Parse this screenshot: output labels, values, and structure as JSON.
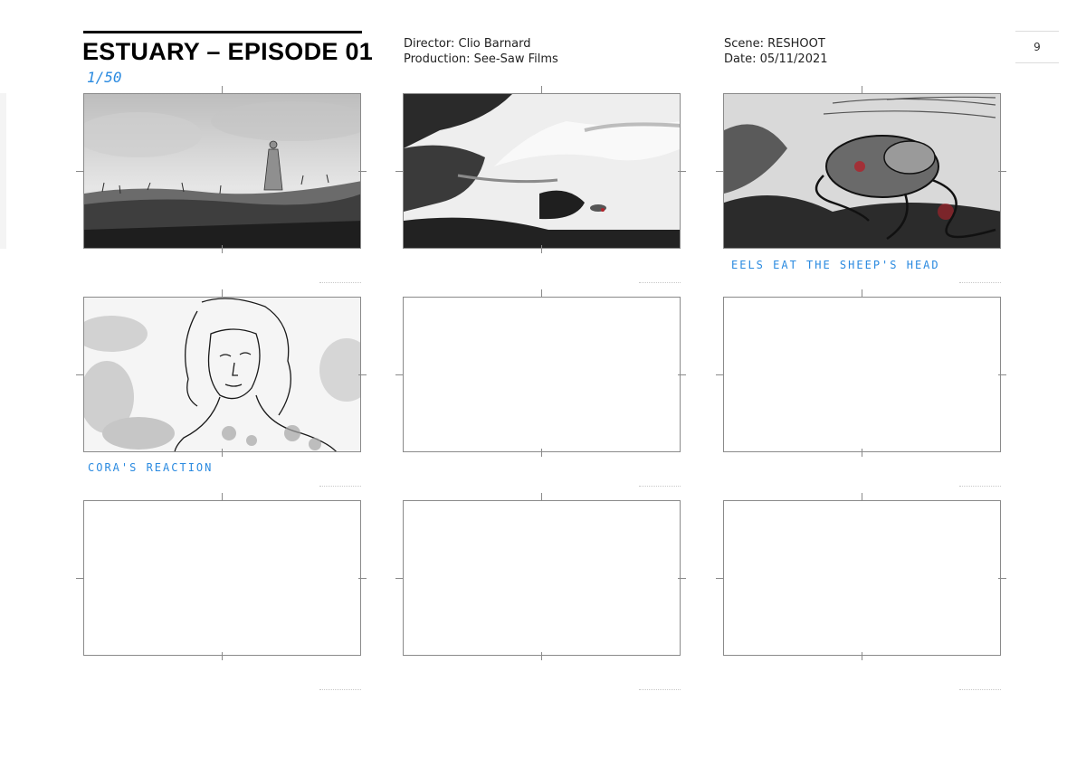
{
  "header": {
    "title": "ESTUARY – EPISODE 01",
    "counter": "1/50",
    "director": "Director: Clio Barnard",
    "production": "Production: See-Saw Films",
    "scene": "Scene: RESHOOT",
    "date": "Date: 05/11/2021",
    "page_number": "9"
  },
  "panels": [
    {
      "id": 1,
      "content": "sketch-figure-on-hill",
      "caption": ""
    },
    {
      "id": 2,
      "content": "sketch-shore-water",
      "caption": ""
    },
    {
      "id": 3,
      "content": "sketch-eels-sheep-head",
      "caption": "EELS EAT THE SHEEP'S HEAD"
    },
    {
      "id": 4,
      "content": "sketch-cora-portrait",
      "caption": "CORA'S REACTION"
    },
    {
      "id": 5,
      "content": "empty",
      "caption": ""
    },
    {
      "id": 6,
      "content": "empty",
      "caption": ""
    },
    {
      "id": 7,
      "content": "empty",
      "caption": ""
    },
    {
      "id": 8,
      "content": "empty",
      "caption": ""
    },
    {
      "id": 9,
      "content": "empty",
      "caption": ""
    }
  ],
  "colors": {
    "annotation": "#2a8ae0",
    "panel_border": "#8a8a8a",
    "blood_accent": "#b0222a"
  }
}
